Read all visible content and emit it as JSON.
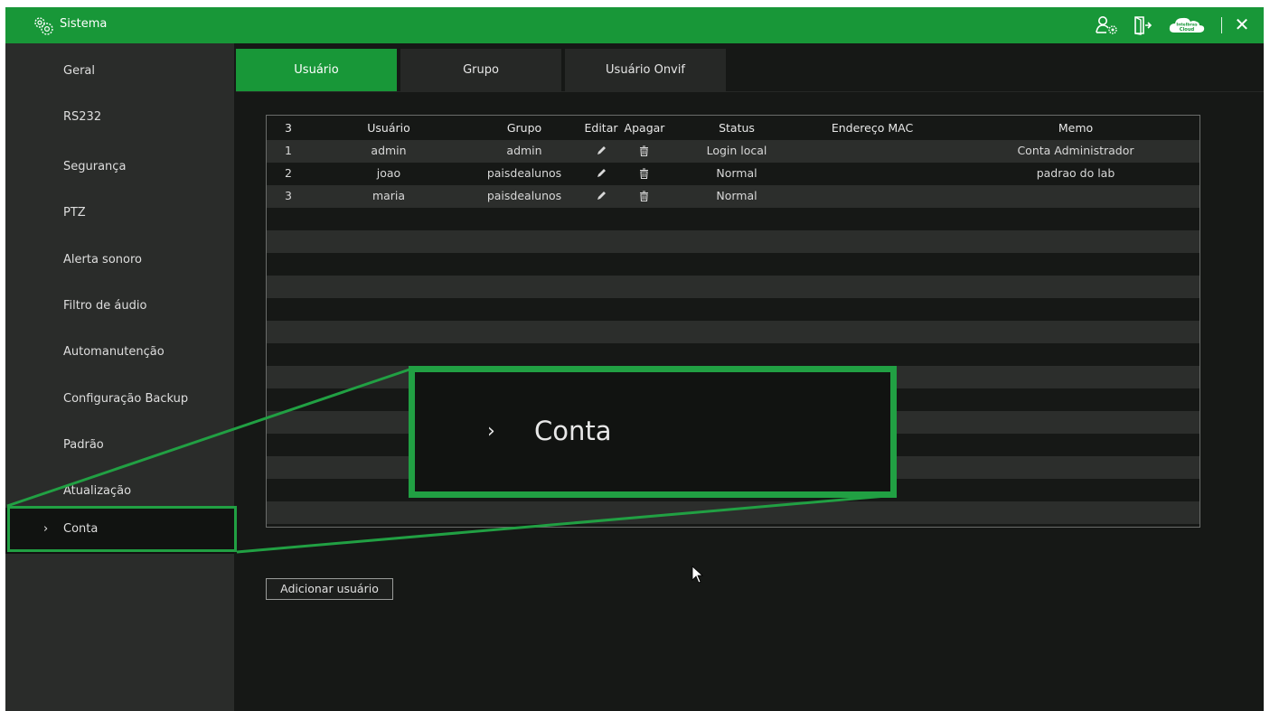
{
  "titlebar": {
    "title": "Sistema",
    "icons": [
      "settings-icon",
      "user-settings-icon",
      "logout-icon",
      "cloud-icon",
      "close-icon"
    ],
    "cloud_badge_top": "Intelbras",
    "cloud_badge_bottom": "Cloud",
    "close_glyph": "✕"
  },
  "sidebar": {
    "items": [
      {
        "label": "Geral"
      },
      {
        "label": "RS232"
      },
      {
        "label": "Segurança"
      },
      {
        "label": "PTZ"
      },
      {
        "label": "Alerta sonoro"
      },
      {
        "label": "Filtro de áudio"
      },
      {
        "label": "Automanutenção"
      },
      {
        "label": "Configuração Backup"
      },
      {
        "label": "Padrão"
      },
      {
        "label": "Atualização"
      },
      {
        "label": "Conta",
        "active": true
      }
    ],
    "active_chevron": "›"
  },
  "tabs": [
    {
      "label": "Usuário",
      "active": true
    },
    {
      "label": "Grupo"
    },
    {
      "label": "Usuário Onvif"
    }
  ],
  "table": {
    "header": {
      "count": "3",
      "user": "Usuário",
      "group": "Grupo",
      "edit": "Editar",
      "delete": "Apagar",
      "status": "Status",
      "mac": "Endereço MAC",
      "memo": "Memo"
    },
    "rows": [
      {
        "num": "1",
        "user": "admin",
        "group": "admin",
        "status": "Login local",
        "mac": "",
        "memo": "Conta Administrador"
      },
      {
        "num": "2",
        "user": "joao",
        "group": "paisdealunos",
        "status": "Normal",
        "mac": "",
        "memo": "padrao do lab"
      },
      {
        "num": "3",
        "user": "maria",
        "group": "paisdealunos",
        "status": "Normal",
        "mac": "",
        "memo": ""
      }
    ]
  },
  "zoom_callout": {
    "chevron": "›",
    "label": "Conta"
  },
  "add_user_button": "Adicionar usuário",
  "colors": {
    "accent": "#189738",
    "highlight": "#21a043",
    "background": "#161816",
    "sidebar": "#2a2c2a"
  }
}
